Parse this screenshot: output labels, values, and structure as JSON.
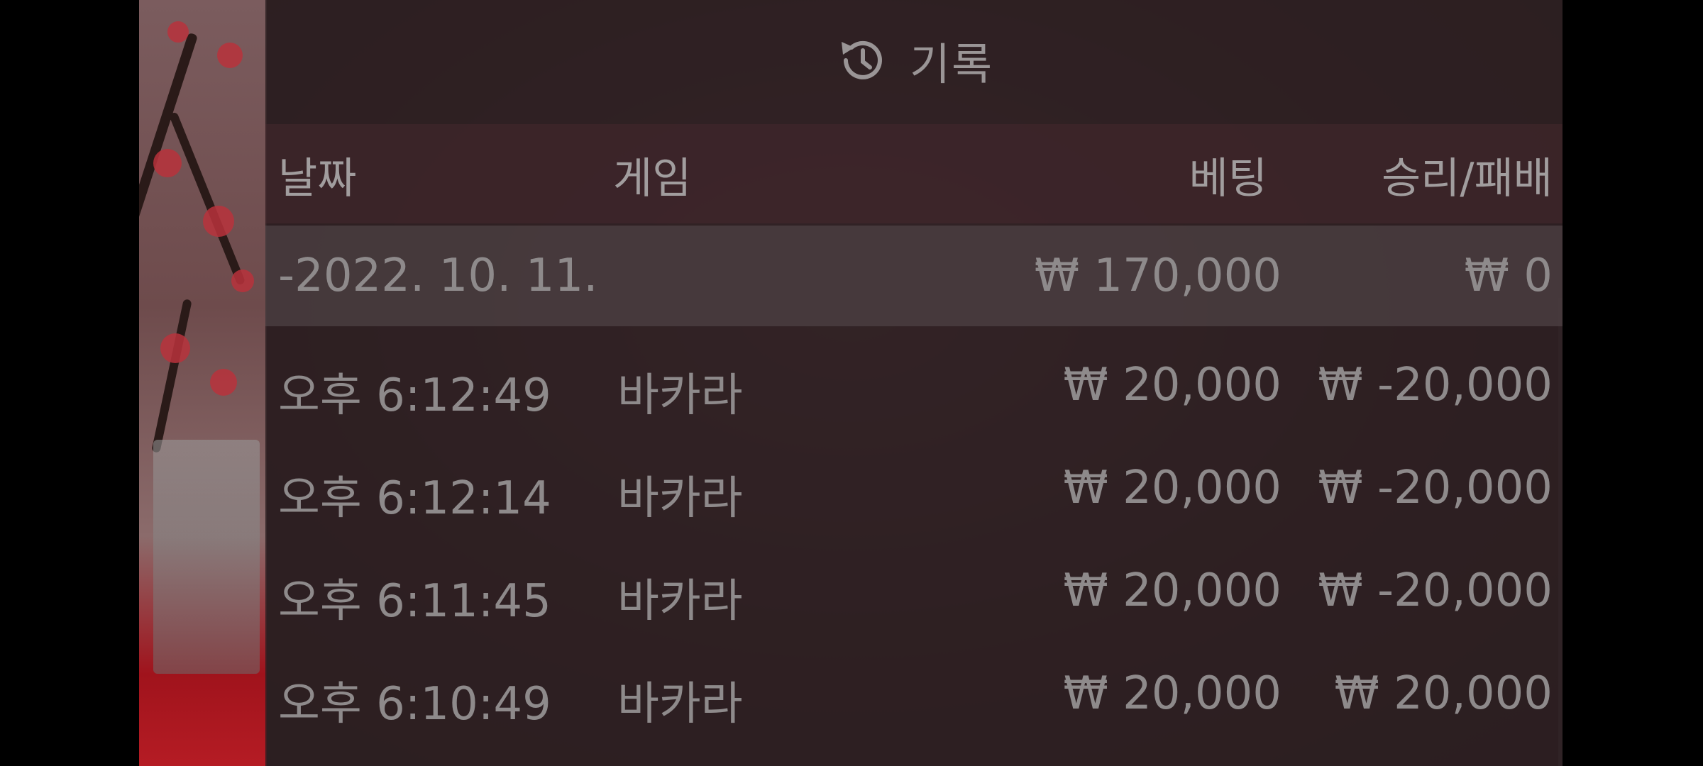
{
  "header": {
    "title": "기록",
    "icon": "history-icon"
  },
  "columns": {
    "date": "날짜",
    "game": "게임",
    "bet": "베팅",
    "win_loss": "승리/패배"
  },
  "summary": {
    "date": "-2022. 10. 11.",
    "bet": "₩ 170,000",
    "win_loss": "₩ 0"
  },
  "rows": [
    {
      "time": "오후 6:12:49",
      "game": "바카라",
      "bet": "₩ 20,000",
      "win_loss": "₩ -20,000"
    },
    {
      "time": "오후 6:12:14",
      "game": "바카라",
      "bet": "₩ 20,000",
      "win_loss": "₩ -20,000"
    },
    {
      "time": "오후 6:11:45",
      "game": "바카라",
      "bet": "₩ 20,000",
      "win_loss": "₩ -20,000"
    },
    {
      "time": "오후 6:10:49",
      "game": "바카라",
      "bet": "₩ 20,000",
      "win_loss": "₩ 20,000"
    }
  ]
}
